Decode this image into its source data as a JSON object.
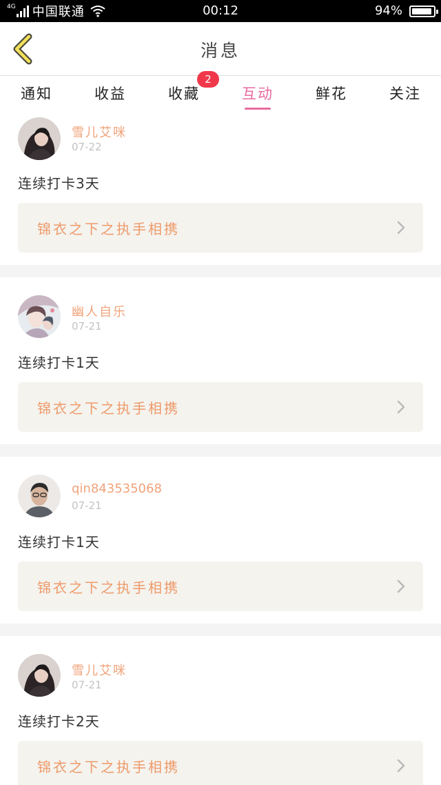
{
  "status_bar": {
    "network": "4G",
    "carrier": "中国联通",
    "time": "00:12",
    "battery": "94%"
  },
  "header": {
    "back_icon": "chevron-left-icon",
    "title": "消息"
  },
  "tabs": [
    {
      "label": "通知"
    },
    {
      "label": "收益"
    },
    {
      "label": "收藏",
      "badge": "2"
    },
    {
      "label": "互动",
      "active": true
    },
    {
      "label": "鲜花"
    },
    {
      "label": "关注"
    }
  ],
  "colors": {
    "accent": "#e86aa0",
    "badge": "#f0384a",
    "username": "#f0a37a",
    "book_title": "#ee9a6a"
  },
  "feed": [
    {
      "user": "雪儿艾咪",
      "date": "07-22",
      "message": "连续打卡3天",
      "book": "锦衣之下之执手相携"
    },
    {
      "user": "幽人自乐",
      "date": "07-21",
      "message": "连续打卡1天",
      "book": "锦衣之下之执手相携"
    },
    {
      "user": "qin843535068",
      "date": "07-21",
      "message": "连续打卡1天",
      "book": "锦衣之下之执手相携"
    },
    {
      "user": "雪儿艾咪",
      "date": "07-21",
      "message": "连续打卡2天",
      "book": "锦衣之下之执手相携"
    }
  ]
}
